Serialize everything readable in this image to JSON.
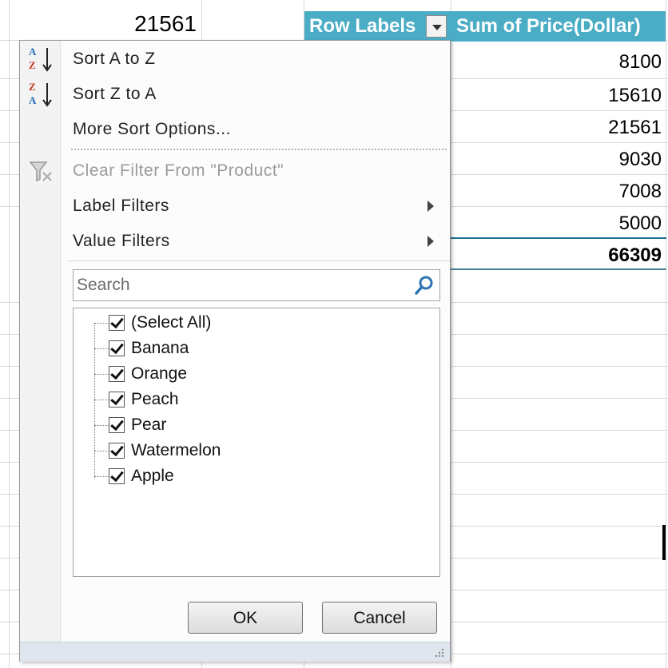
{
  "sheet": {
    "top_left_cell": "21561",
    "pivot": {
      "row_labels_header": "Row Labels",
      "sum_header": "Sum of Price(Dollar)",
      "values": [
        "8100",
        "15610",
        "21561",
        "9030",
        "7008",
        "5000"
      ],
      "grand_total": "66309",
      "header_color": "#4bacc6"
    }
  },
  "filter_menu": {
    "sort_az": "Sort A to Z",
    "sort_za": "Sort Z to A",
    "more_sort": "More Sort Options...",
    "clear_filter": "Clear Filter From \"Product\"",
    "label_filters": "Label Filters",
    "value_filters": "Value Filters",
    "search_placeholder": "Search",
    "items": [
      {
        "label": "(Select All)",
        "checked": true
      },
      {
        "label": "Banana",
        "checked": true
      },
      {
        "label": "Orange",
        "checked": true
      },
      {
        "label": "Peach",
        "checked": true
      },
      {
        "label": "Pear",
        "checked": true
      },
      {
        "label": "Watermelon",
        "checked": true
      },
      {
        "label": "Apple",
        "checked": true
      }
    ],
    "ok_label": "OK",
    "cancel_label": "Cancel"
  },
  "icons": {
    "sort_az": "sort-ascending-icon",
    "sort_za": "sort-descending-icon",
    "clear_filter": "clear-filter-icon",
    "search": "magnifier-icon",
    "submenu": "chevron-right-icon"
  }
}
